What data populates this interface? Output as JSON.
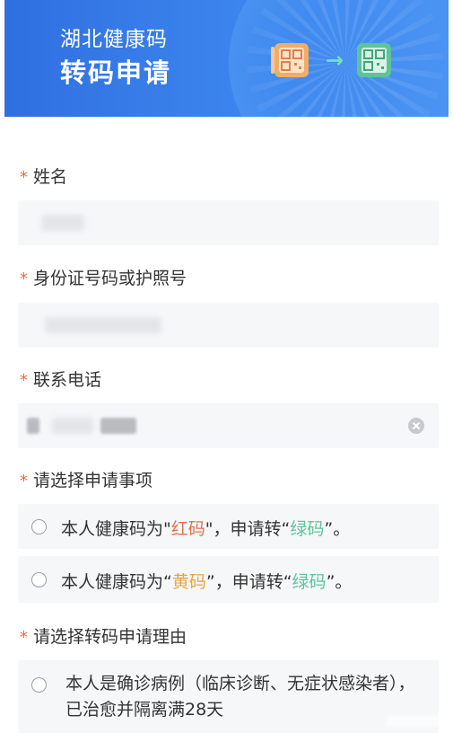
{
  "banner": {
    "title": "湖北健康码",
    "subtitle": "转码申请",
    "icon": "qr-convert-icon",
    "arrow": "→",
    "colors": {
      "banner": "#3d86ee",
      "qr_from": "#f0ad6a",
      "qr_to": "#5fc39a"
    }
  },
  "form": {
    "required_mark": "*",
    "name": {
      "label": "姓名",
      "value": ""
    },
    "id_number": {
      "label": "身份证号码或护照号",
      "value": ""
    },
    "phone": {
      "label": "联系电话",
      "value": "",
      "clear_icon": "clear-icon"
    },
    "matter": {
      "label": "请选择申请事项",
      "options": [
        {
          "prefix": "本人健康码为\"",
          "from": "红码",
          "middle": "\"，申请转“",
          "to": "绿码",
          "suffix": "”。"
        },
        {
          "prefix": "本人健康码为“",
          "from": "黄码",
          "middle": "”，申请转“",
          "to": "绿码",
          "suffix": "”。"
        }
      ]
    },
    "reason": {
      "label": "请选择转码申请理由",
      "options": [
        {
          "text": "本人是确诊病例（临床诊断、无症状感染者），已治愈并隔离满28天"
        }
      ]
    }
  },
  "colors": {
    "accent_star": "#e96b3c",
    "red_code": "#e0734b",
    "yellow_code": "#e3a53e",
    "green_code": "#5fc39a",
    "field_bg": "#f6f7f9"
  }
}
